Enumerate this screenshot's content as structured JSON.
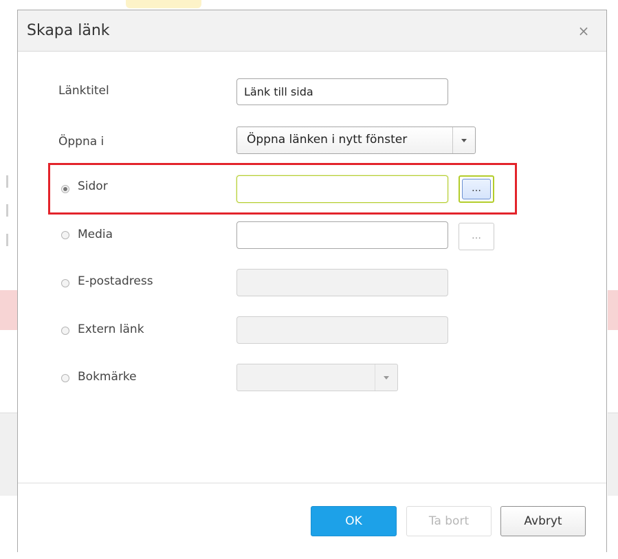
{
  "dialog": {
    "title": "Skapa länk",
    "close_glyph": "×"
  },
  "form": {
    "link_title": {
      "label": "Länktitel",
      "value": "Länk till sida"
    },
    "open_in": {
      "label": "Öppna i",
      "selected": "Öppna länken i nytt fönster"
    },
    "link_types": [
      {
        "label": "Sidor",
        "checked": true,
        "value": "",
        "browse": "…"
      },
      {
        "label": "Media",
        "checked": false,
        "value": "",
        "browse": "…"
      },
      {
        "label": "E-postadress",
        "checked": false,
        "value": ""
      },
      {
        "label": "Extern länk",
        "checked": false,
        "value": ""
      },
      {
        "label": "Bokmärke",
        "checked": false,
        "selected": ""
      }
    ]
  },
  "footer": {
    "ok": "OK",
    "remove": "Ta bort",
    "cancel": "Avbryt"
  },
  "colors": {
    "primary_button": "#1da1e8",
    "focus_border": "#b3cd2a",
    "highlight": "#e3242b"
  }
}
